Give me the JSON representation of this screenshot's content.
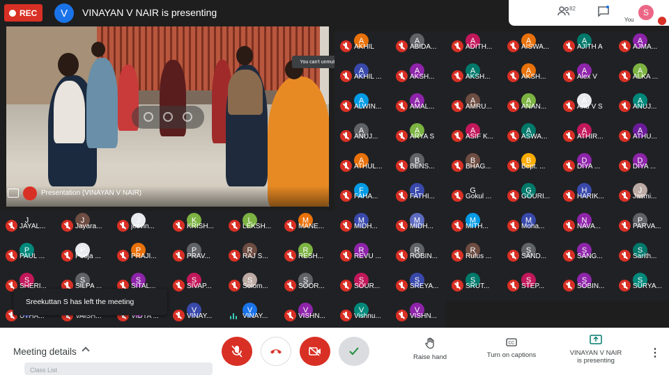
{
  "topbar": {
    "rec_label": "REC",
    "presenter_initial": "V",
    "presenter_title": "VINAYAN V NAIR is presenting",
    "participant_count": "82",
    "you_initial": "S",
    "you_label": "You"
  },
  "video": {
    "label": "Presentation (VINAYAN V NAIR)",
    "tooltip": "You can't unmute someone else"
  },
  "toast": "Sreekuttan S has left the meeting",
  "participants": [
    {
      "name": "AKHIL",
      "initial": "A",
      "color": "#e8710a"
    },
    {
      "name": "ABIDA...",
      "initial": "A",
      "color": "#5f6368"
    },
    {
      "name": "ADITH...",
      "initial": "A",
      "color": "#c2185b"
    },
    {
      "name": "AISWA...",
      "initial": "A",
      "color": "#e8710a"
    },
    {
      "name": "AJITH A",
      "initial": "A",
      "color": "#00796b"
    },
    {
      "name": "AJMA...",
      "initial": "A",
      "color": "#8e24aa"
    },
    {
      "name": "AKHIL ...",
      "initial": "A",
      "color": "#3949ab"
    },
    {
      "name": "AKSH...",
      "initial": "A",
      "color": "#8e24aa"
    },
    {
      "name": "AKSH...",
      "initial": "A",
      "color": "#00796b"
    },
    {
      "name": "AKSH...",
      "initial": "A",
      "color": "#e8710a"
    },
    {
      "name": "Alex V",
      "initial": "A",
      "color": "#8e24aa"
    },
    {
      "name": "ALKA ...",
      "initial": "A",
      "color": "#7cb342"
    },
    {
      "name": "ALWIN...",
      "initial": "A",
      "color": "#039be5"
    },
    {
      "name": "AMAL...",
      "initial": "A",
      "color": "#8e24aa"
    },
    {
      "name": "AMRU...",
      "initial": "A",
      "color": "#6d4c41"
    },
    {
      "name": "ANAN...",
      "initial": "A",
      "color": "#7cb342"
    },
    {
      "name": "Anu V S",
      "initial": "A",
      "color": "#e8eaed"
    },
    {
      "name": "ANUJ...",
      "initial": "A",
      "color": "#00897b"
    },
    {
      "name": "ANUJ...",
      "initial": "A",
      "color": "#5f6368"
    },
    {
      "name": "ARYA S",
      "initial": "A",
      "color": "#7cb342"
    },
    {
      "name": "ASIF K...",
      "initial": "A",
      "color": "#c2185b"
    },
    {
      "name": "ASWA...",
      "initial": "A",
      "color": "#00796b"
    },
    {
      "name": "ATHIR...",
      "initial": "A",
      "color": "#c2185b"
    },
    {
      "name": "ATHU...",
      "initial": "A",
      "color": "#6a1b9a"
    },
    {
      "name": "ATHUL...",
      "initial": "A",
      "color": "#e8710a"
    },
    {
      "name": "BENS...",
      "initial": "B",
      "color": "#5f6368"
    },
    {
      "name": "BHAG...",
      "initial": "B",
      "color": "#6d4c41"
    },
    {
      "name": "Bept. ...",
      "initial": "B",
      "color": "#f9ab00"
    },
    {
      "name": "DIYA ...",
      "initial": "D",
      "color": "#8e24aa"
    },
    {
      "name": "DIYA ...",
      "initial": "D",
      "color": "#8e24aa"
    },
    {
      "name": "FAHA...",
      "initial": "F",
      "color": "#039be5"
    },
    {
      "name": "FATHI...",
      "initial": "F",
      "color": "#3949ab"
    },
    {
      "name": "Gokul ...",
      "initial": "G",
      "color": "#202124"
    },
    {
      "name": "GOURI...",
      "initial": "G",
      "color": "#00796b"
    },
    {
      "name": "HARIK...",
      "initial": "H",
      "color": "#3949ab"
    },
    {
      "name": "Jasmi...",
      "initial": "J",
      "color": "#bcaaa4"
    },
    {
      "name": "JAYAL...",
      "initial": "J",
      "color": "#202124"
    },
    {
      "name": "Jayara...",
      "initial": "J",
      "color": "#6d4c41"
    },
    {
      "name": "jesvin...",
      "initial": "J",
      "color": "#e8eaed"
    },
    {
      "name": "KRISH...",
      "initial": "K",
      "color": "#7cb342"
    },
    {
      "name": "LEKSH...",
      "initial": "L",
      "color": "#7cb342"
    },
    {
      "name": "MANE...",
      "initial": "M",
      "color": "#e8710a"
    },
    {
      "name": "MIDH...",
      "initial": "M",
      "color": "#3949ab"
    },
    {
      "name": "MIDH...",
      "initial": "M",
      "color": "#5c6bc0"
    },
    {
      "name": "MITH...",
      "initial": "M",
      "color": "#039be5"
    },
    {
      "name": "Moha...",
      "initial": "M",
      "color": "#3949ab"
    },
    {
      "name": "NAVA...",
      "initial": "N",
      "color": "#8e24aa"
    },
    {
      "name": "PARVA...",
      "initial": "P",
      "color": "#5f6368"
    },
    {
      "name": "PAUL ...",
      "initial": "P",
      "color": "#00897b"
    },
    {
      "name": "Pooja ...",
      "initial": "P",
      "color": "#e8eaed"
    },
    {
      "name": "PRAJI...",
      "initial": "P",
      "color": "#e8710a"
    },
    {
      "name": "PRAV...",
      "initial": "P",
      "color": "#5f6368"
    },
    {
      "name": "RAJ S...",
      "initial": "R",
      "color": "#6d4c41"
    },
    {
      "name": "RESH...",
      "initial": "R",
      "color": "#7cb342"
    },
    {
      "name": "REVU ...",
      "initial": "R",
      "color": "#8e24aa"
    },
    {
      "name": "ROBIN...",
      "initial": "R",
      "color": "#5f6368"
    },
    {
      "name": "Rufus ...",
      "initial": "R",
      "color": "#6d4c41"
    },
    {
      "name": "SAND...",
      "initial": "S",
      "color": "#5f6368"
    },
    {
      "name": "SANG...",
      "initial": "S",
      "color": "#8e24aa"
    },
    {
      "name": "Sarith...",
      "initial": "S",
      "color": "#00796b"
    },
    {
      "name": "SHERI...",
      "initial": "S",
      "color": "#c2185b"
    },
    {
      "name": "SILPA ...",
      "initial": "S",
      "color": "#5f6368"
    },
    {
      "name": "SITAL...",
      "initial": "S",
      "color": "#8e24aa"
    },
    {
      "name": "SIVAP...",
      "initial": "S",
      "color": "#c2185b"
    },
    {
      "name": "Solom...",
      "initial": "S",
      "color": "#bcaaa4"
    },
    {
      "name": "SOOR...",
      "initial": "S",
      "color": "#5f6368"
    },
    {
      "name": "SOUR...",
      "initial": "S",
      "color": "#c2185b"
    },
    {
      "name": "SREYA...",
      "initial": "S",
      "color": "#3949ab"
    },
    {
      "name": "SRUT...",
      "initial": "S",
      "color": "#00796b"
    },
    {
      "name": "STEP...",
      "initial": "S",
      "color": "#c2185b"
    },
    {
      "name": "SOBIN...",
      "initial": "S",
      "color": "#8e24aa"
    },
    {
      "name": "SURYA...",
      "initial": "S",
      "color": "#00897b"
    },
    {
      "name": "UTHA...",
      "initial": "U",
      "color": "#3949ab"
    },
    {
      "name": "VAISH...",
      "initial": "V",
      "color": "#5f6368"
    },
    {
      "name": "VIDYA ...",
      "initial": "V",
      "color": "#8e24aa"
    },
    {
      "name": "VINAY...",
      "initial": "V",
      "color": "#3949ab"
    },
    {
      "name": "VINAY...",
      "initial": "V",
      "color": "#1a73e8",
      "speaking": true
    },
    {
      "name": "VISHN...",
      "initial": "V",
      "color": "#8e24aa"
    },
    {
      "name": "Vishnu...",
      "initial": "V",
      "color": "#00897b"
    },
    {
      "name": "VISHN...",
      "initial": "V",
      "color": "#8e24aa"
    }
  ],
  "bottombar": {
    "meeting_details": "Meeting details",
    "class_list": "Class List",
    "raise_hand": "Raise hand",
    "captions": "Turn on captions",
    "presenting_line1": "VINAYAN V NAIR",
    "presenting_line2": "is presenting"
  },
  "icons": {
    "mic_off": "mic-off-icon",
    "hang_up": "hang-up-icon",
    "camera_off": "camera-off-icon",
    "check": "check-icon",
    "raise_hand": "hand-icon",
    "captions": "cc-icon",
    "present": "present-icon",
    "more": "more-vert-icon",
    "people": "people-icon",
    "chat": "chat-icon"
  },
  "colors": {
    "accent_red": "#d93025",
    "background": "#1e1e1e",
    "speaking": "#4fd1c5"
  }
}
